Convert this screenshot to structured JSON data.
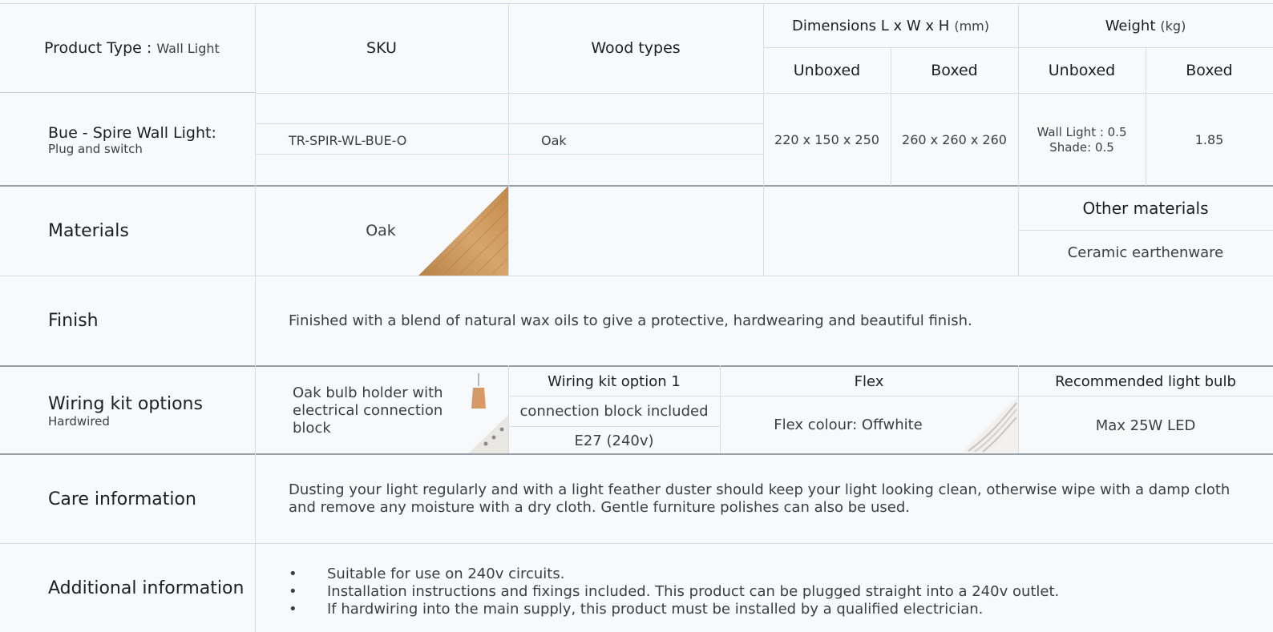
{
  "header": {
    "product_type_label": "Product Type : ",
    "product_type_value": "Wall Light",
    "sku_label": "SKU",
    "wood_types_label": "Wood types",
    "dimensions_label": "Dimensions L x W x H",
    "dimensions_unit": "(mm)",
    "weight_label": "Weight",
    "weight_unit": "(kg)",
    "unboxed_label": "Unboxed",
    "boxed_label": "Boxed"
  },
  "product": {
    "name": "Bue - Spire Wall Light:",
    "variant": "Plug and switch",
    "sku": "TR-SPIR-WL-BUE-O",
    "wood": "Oak",
    "dim_unboxed": "220 x 150 x 250",
    "dim_boxed": "260 x 260 x 260",
    "weight_unboxed_line1": "Wall Light : 0.5",
    "weight_unboxed_line2": "Shade: 0.5",
    "weight_boxed": "1.85"
  },
  "materials": {
    "label": "Materials",
    "wood": "Oak",
    "other_label": "Other materials",
    "other_value": "Ceramic earthenware"
  },
  "finish": {
    "label": "Finish",
    "text": "Finished with a blend of natural wax oils to give a protective, hardwearing and beautiful finish."
  },
  "wiring": {
    "label": "Wiring kit options",
    "sub": "Hardwired",
    "holder_text": "Oak bulb holder with electrical connection block",
    "option_label": "Wiring kit option 1",
    "option_line1": "connection block included",
    "option_line2": "E27 (240v)",
    "flex_label": "Flex",
    "flex_value": "Flex colour: Offwhite",
    "bulb_label": "Recommended light bulb",
    "bulb_value": "Max 25W LED"
  },
  "care": {
    "label": "Care information",
    "text": "Dusting your light regularly and with a light feather duster should keep your light looking clean, otherwise wipe with a damp cloth and remove any moisture with a dry cloth. Gentle furniture polishes can also be used."
  },
  "additional": {
    "label": "Additional information",
    "items": [
      "Suitable for use on 240v circuits.",
      "Installation instructions and fixings included. This product can be plugged straight into a 240v outlet.",
      "If hardwiring into the main supply, this product must be installed by a qualified electrician."
    ]
  },
  "colors": {
    "grid": "#d5dde6",
    "divider": "#9a9fa5",
    "oak": "#c9955a"
  }
}
